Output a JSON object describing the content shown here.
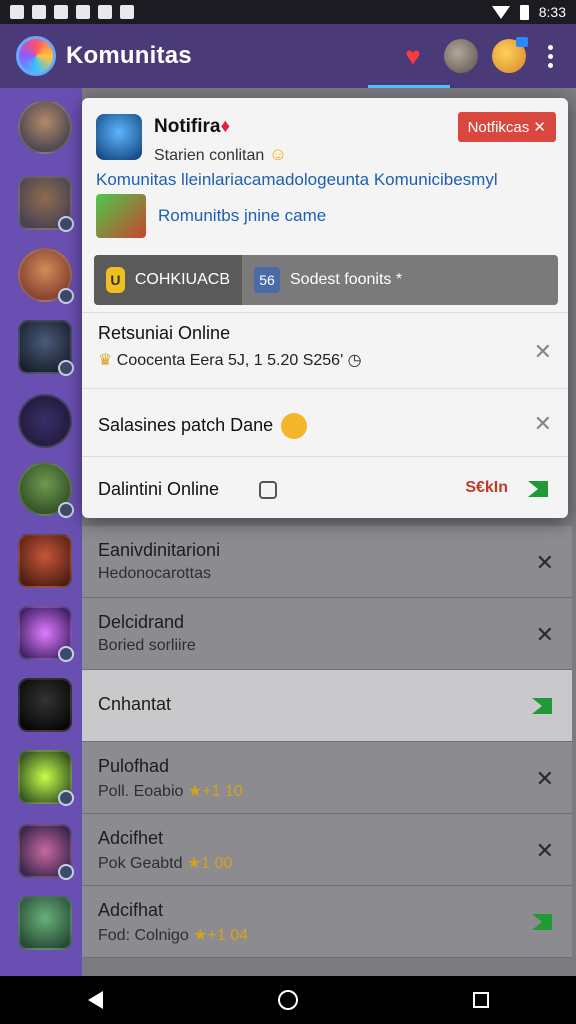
{
  "status_bar": {
    "time": "8:33"
  },
  "app_bar": {
    "title": "Komunitas"
  },
  "popup": {
    "title": "Notifira",
    "meta": "Starien conlitan",
    "close_label": "Notfikcas ✕",
    "link_text": "Komunitas lleinlariacamadologeunta Komunicibesmyl",
    "game_name": "Romunitbs jnine came",
    "tabs": [
      {
        "icon_text": "U",
        "label": "COHKIUACB"
      },
      {
        "icon_text": "56",
        "label": "Sodest foonits *"
      }
    ],
    "items": [
      {
        "title": "Retsuniai Online",
        "sub": "Coocenta Eera 5J, 1 5.20 S256'"
      },
      {
        "title": "Salasines patch Dane"
      },
      {
        "title": "Dalintini Online",
        "status": "S€kIn"
      }
    ]
  },
  "list": [
    {
      "title": "Eanivdinitarioni",
      "sub": "Hedonocarottas",
      "action": "close"
    },
    {
      "title": "Delcidrand",
      "sub": "Boried sorliire",
      "action": "close"
    },
    {
      "title": "Cnhantat",
      "sub": "",
      "action": "check"
    },
    {
      "title": "Pulofhad",
      "sub": "Poll. Eoabio",
      "rating": "★+1 10",
      "action": "close"
    },
    {
      "title": "Adcifhet",
      "sub": "Pok Geabtd",
      "rating": "★1 00",
      "action": "close"
    },
    {
      "title": "Adcifhat",
      "sub": "Fod: Colnigo",
      "rating": "★+1 04",
      "action": "check"
    }
  ]
}
